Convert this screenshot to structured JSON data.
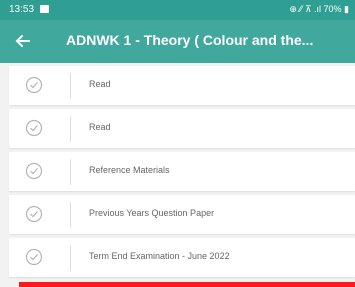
{
  "status_bar": {
    "time": "13:53",
    "right": "⊕ ⁄⁄ ⊼ .ıl 70% ▮"
  },
  "app_bar": {
    "title": "ADNWK 1 - Theory ( Colour and the..."
  },
  "items": [
    {
      "label": "Read"
    },
    {
      "label": "Read"
    },
    {
      "label": "Reference Materials"
    },
    {
      "label": "Previous Years Question Paper"
    },
    {
      "label": "Term End Examination - June 2022"
    }
  ],
  "colors": {
    "app_bar": "#40a89c",
    "status_bar": "#2f9e93",
    "accent_bar": "#ff1a1a"
  }
}
